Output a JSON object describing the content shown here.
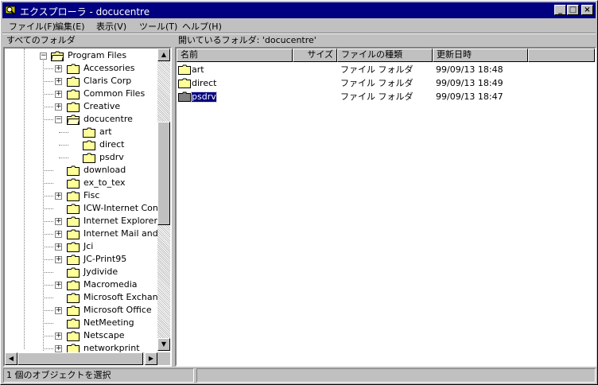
{
  "window": {
    "title": "エクスプローラ - docucentre",
    "minimize_glyph": "_",
    "maximize_glyph": "□",
    "close_glyph": "×"
  },
  "menubar": {
    "items": [
      "ファイル(F)",
      "編集(E)",
      "表示(V)",
      "ツール(T)",
      "ヘルプ(H)"
    ]
  },
  "tree_header": "すべてのフォルダ",
  "list_header": "開いているフォルダ: 'docucentre'",
  "tree": {
    "items": [
      {
        "label": "Program Files",
        "level": 0,
        "expander": "-",
        "open": true
      },
      {
        "label": "Accessories",
        "level": 1,
        "expander": "+"
      },
      {
        "label": "Claris Corp",
        "level": 1,
        "expander": "+"
      },
      {
        "label": "Common Files",
        "level": 1,
        "expander": "+"
      },
      {
        "label": "Creative",
        "level": 1,
        "expander": "+"
      },
      {
        "label": "docucentre",
        "level": 1,
        "expander": "-",
        "open": true
      },
      {
        "label": "art",
        "level": 2,
        "expander": ""
      },
      {
        "label": "direct",
        "level": 2,
        "expander": ""
      },
      {
        "label": "psdrv",
        "level": 2,
        "expander": ""
      },
      {
        "label": "download",
        "level": 1,
        "expander": ""
      },
      {
        "label": "ex_to_tex",
        "level": 1,
        "expander": ""
      },
      {
        "label": "Fisc",
        "level": 1,
        "expander": "+"
      },
      {
        "label": "ICW-Internet Conn",
        "level": 1,
        "expander": ""
      },
      {
        "label": "Internet Explorer",
        "level": 1,
        "expander": "+"
      },
      {
        "label": "Internet Mail and N",
        "level": 1,
        "expander": "+"
      },
      {
        "label": "Jci",
        "level": 1,
        "expander": "+"
      },
      {
        "label": "JC-Print95",
        "level": 1,
        "expander": "+"
      },
      {
        "label": "Jydivide",
        "level": 1,
        "expander": ""
      },
      {
        "label": "Macromedia",
        "level": 1,
        "expander": "+"
      },
      {
        "label": "Microsoft Exchang",
        "level": 1,
        "expander": ""
      },
      {
        "label": "Microsoft Office",
        "level": 1,
        "expander": "+"
      },
      {
        "label": "NetMeeting",
        "level": 1,
        "expander": ""
      },
      {
        "label": "Netscape",
        "level": 1,
        "expander": "+"
      },
      {
        "label": "networkprint",
        "level": 1,
        "expander": "+"
      }
    ]
  },
  "list": {
    "columns": [
      "名前",
      "サイズ",
      "ファイルの種類",
      "更新日時"
    ],
    "rows": [
      {
        "name": "art",
        "size": "",
        "type": "ファイル フォルダ",
        "modified": "99/09/13 18:48",
        "selected": false
      },
      {
        "name": "direct",
        "size": "",
        "type": "ファイル フォルダ",
        "modified": "99/09/13 18:49",
        "selected": false
      },
      {
        "name": "psdrv",
        "size": "",
        "type": "ファイル フォルダ",
        "modified": "99/09/13 18:47",
        "selected": true
      }
    ]
  },
  "status": {
    "left": "1 個のオブジェクトを選択",
    "right": ""
  },
  "colors": {
    "titlebar": "#000080",
    "face": "#c0c0c0",
    "folder": "#ffff99",
    "selection": "#000080"
  }
}
